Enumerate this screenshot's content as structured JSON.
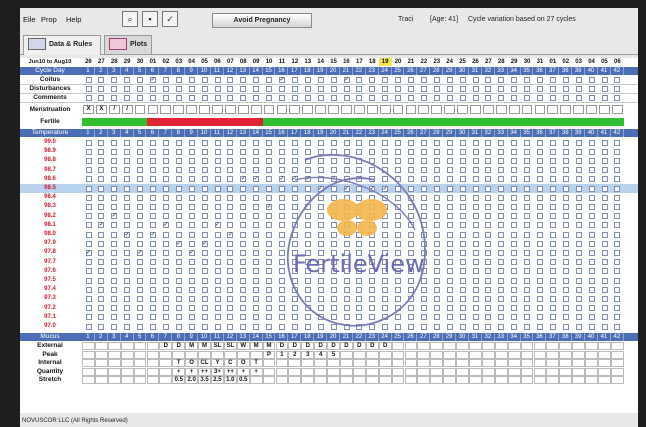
{
  "menu": {
    "file": "Eile",
    "prop": "Prop",
    "help": "Help"
  },
  "toolbar": {
    "avoid_button": "Avoid Pregnancy",
    "icons": [
      "search-icon",
      "save-icon",
      "checkbox-icon"
    ]
  },
  "header": {
    "user": "Traci",
    "age": "[Age: 41]",
    "cycle_variation": "Cycle variation based on  27 cycles"
  },
  "tabs": [
    {
      "label": "Data & Rules",
      "icon": "notebook-icon",
      "active": true
    },
    {
      "label": "Plots",
      "icon": "plot-icon",
      "active": false
    }
  ],
  "chart": {
    "date_range": "Jun10 to Aug10",
    "dates": [
      "26",
      "27",
      "28",
      "29",
      "30",
      "01",
      "02",
      "03",
      "04",
      "05",
      "06",
      "07",
      "08",
      "09",
      "10",
      "11",
      "12",
      "13",
      "14",
      "15",
      "16",
      "17",
      "18",
      "19",
      "20",
      "21",
      "22",
      "23",
      "24",
      "25",
      "26",
      "27",
      "28",
      "29",
      "30",
      "31",
      "01",
      "02",
      "03",
      "04",
      "05",
      "06"
    ],
    "today_index": 23,
    "cycle_days": [
      "1",
      "2",
      "3",
      "4",
      "5",
      "6",
      "7",
      "8",
      "9",
      "10",
      "11",
      "12",
      "13",
      "14",
      "15",
      "16",
      "17",
      "18",
      "19",
      "20",
      "21",
      "22",
      "23",
      "24",
      "25",
      "26",
      "27",
      "28",
      "29",
      "30",
      "31",
      "32",
      "33",
      "34",
      "35",
      "36",
      "37",
      "38",
      "39",
      "40",
      "41",
      "42"
    ],
    "labels": {
      "cycle_day": "Cycle Day",
      "coitus": "Coitus",
      "disturbances": "Disturbances",
      "comments": "Comments",
      "menstruation": "Menstruation",
      "fertile": "Fertile",
      "temperature": "Temperature",
      "mucus": "Mucus",
      "external": "External",
      "peak": "Peak",
      "internal": "Internal",
      "quantity": "Quantity",
      "stretch": "Stretch"
    },
    "menstruation": [
      "X",
      "X",
      "/",
      "/"
    ],
    "temps": [
      "99.0",
      "98.9",
      "98.8",
      "98.7",
      "98.6",
      "98.5",
      "98.4",
      "98.3",
      "98.2",
      "98.1",
      "98.0",
      "97.9",
      "97.8",
      "97.7",
      "97.6",
      "97.5",
      "97.4",
      "97.3",
      "97.2",
      "97.1",
      "97.0"
    ],
    "highlight_temp": "98.5",
    "fertile": {
      "green_before": 5,
      "red_start": 5,
      "red_end": 14,
      "total": 42
    },
    "temp_points": [
      {
        "day": 1,
        "temp": "97.8"
      },
      {
        "day": 2,
        "temp": "98.1"
      },
      {
        "day": 3,
        "temp": "98.2"
      },
      {
        "day": 4,
        "temp": "98.0"
      },
      {
        "day": 5,
        "temp": "97.8"
      },
      {
        "day": 6,
        "temp": "98.0"
      },
      {
        "day": 7,
        "temp": "98.1"
      },
      {
        "day": 8,
        "temp": "97.9"
      },
      {
        "day": 9,
        "temp": "97.8"
      },
      {
        "day": 10,
        "temp": "97.9"
      },
      {
        "day": 11,
        "temp": "98.1"
      },
      {
        "day": 12,
        "temp": "98.0"
      },
      {
        "day": 13,
        "temp": "98.6"
      },
      {
        "day": 14,
        "temp": "98.6"
      },
      {
        "day": 15,
        "temp": "98.3"
      },
      {
        "day": 16,
        "temp": "98.6"
      },
      {
        "day": 17,
        "temp": "98.6"
      },
      {
        "day": 18,
        "temp": "98.6"
      },
      {
        "day": 19,
        "temp": "98.5"
      },
      {
        "day": 20,
        "temp": "98.6"
      },
      {
        "day": 21,
        "temp": "98.5"
      },
      {
        "day": 22,
        "temp": "98.6"
      },
      {
        "day": 23,
        "temp": "98.5"
      },
      {
        "day": 24,
        "temp": "98.5"
      }
    ],
    "coitus_days": [
      6,
      16,
      21
    ],
    "external": {
      "7": "D",
      "8": "D",
      "9": "M",
      "10": "M",
      "11": "SL",
      "12": "SL",
      "13": "W",
      "14": "M",
      "15": "M",
      "16": "D",
      "17": "D",
      "18": "D",
      "19": "D",
      "20": "D",
      "21": "D",
      "22": "D",
      "23": "D",
      "24": "D"
    },
    "peak": {
      "15": "P",
      "16": "1",
      "17": "2",
      "18": "3",
      "19": "4",
      "20": "5"
    },
    "internal": {
      "8": "T",
      "9": "O",
      "10": "CL",
      "11": "Y",
      "12": "C",
      "13": "O",
      "14": "T"
    },
    "quantity": {
      "8": "+",
      "9": "+",
      "10": "++",
      "11": "3+",
      "12": "++",
      "13": "+",
      "14": "+"
    },
    "stretch": {
      "8": "0.5",
      "9": "2.0",
      "10": "3.5",
      "11": "2.5",
      "12": "1.0",
      "13": "0.5"
    },
    "watermark": "FertileView"
  },
  "footer": {
    "text": "NOVUSCOR LLC (All Rights Reserved)"
  },
  "colors": {
    "band": "#4b6fb7",
    "temp_label": "#d9162f",
    "fertile_green": "#2fc02f",
    "fertile_red": "#e02331",
    "today": "#f2e64d"
  }
}
